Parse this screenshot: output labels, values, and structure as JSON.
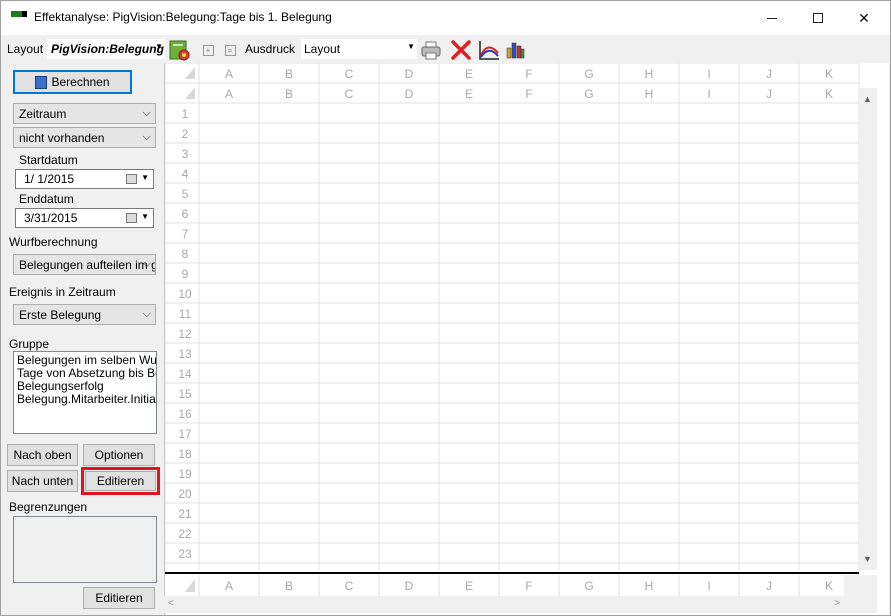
{
  "window": {
    "title": "Effektanalyse: PigVision:Belegung:Tage bis 1. Belegung"
  },
  "toolbar": {
    "layout_label": "Layout",
    "layout_value": "PigVision:Belegung",
    "print_label": "Ausdruck",
    "print_layout_value": "Layout",
    "plus_symbol": "+",
    "minus_symbol": "="
  },
  "panel": {
    "calculate_label": "Berechnen",
    "period_select": "Zeitraum",
    "exists_select": "nicht vorhanden",
    "start_label": "Startdatum",
    "start_value": "1/ 1/2015",
    "end_label": "Enddatum",
    "end_value": "3/31/2015",
    "litter_label": "Wurfberechnung",
    "litter_select": "Belegungen aufteilen im g",
    "event_label": "Ereignis in Zeitraum",
    "event_select": "Erste Belegung",
    "group_label": "Gruppe",
    "group_items": [
      "Belegungen im selben Wurf",
      "Tage von Absetzung bis Bele",
      "Belegungserfolg",
      "Belegung.Mitarbeiter.Initialen"
    ],
    "up_button": "Nach oben",
    "options_button": "Optionen",
    "down_button": "Nach unten",
    "edit_button": "Editieren",
    "limits_label": "Begrenzungen",
    "limits_edit_button": "Editieren"
  },
  "sheet": {
    "columns": [
      "A",
      "B",
      "C",
      "D",
      "E",
      "F",
      "G",
      "H",
      "I",
      "J",
      "K"
    ],
    "rows": [
      "1",
      "2",
      "3",
      "4",
      "5",
      "6",
      "7",
      "8",
      "9",
      "10",
      "11",
      "12",
      "13",
      "14",
      "15",
      "16",
      "17",
      "18",
      "19",
      "20",
      "21",
      "22",
      "23"
    ]
  }
}
